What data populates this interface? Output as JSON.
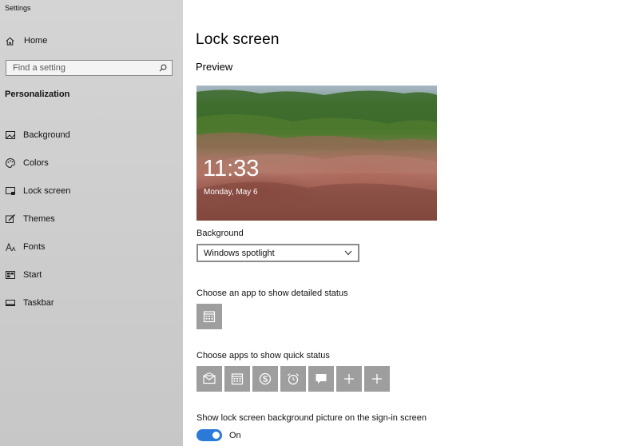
{
  "app": {
    "title": "Settings"
  },
  "sidebar": {
    "home_label": "Home",
    "search_placeholder": "Find a setting",
    "section_title": "Personalization",
    "items": [
      {
        "label": "Background",
        "icon": "picture-icon"
      },
      {
        "label": "Colors",
        "icon": "palette-icon"
      },
      {
        "label": "Lock screen",
        "icon": "lock-screen-icon"
      },
      {
        "label": "Themes",
        "icon": "themes-icon"
      },
      {
        "label": "Fonts",
        "icon": "fonts-icon"
      },
      {
        "label": "Start",
        "icon": "start-icon"
      },
      {
        "label": "Taskbar",
        "icon": "taskbar-icon"
      }
    ]
  },
  "main": {
    "title": "Lock screen",
    "preview_title": "Preview",
    "preview_time": "11:33",
    "preview_date": "Monday, May 6",
    "background_label": "Background",
    "background_value": "Windows spotlight",
    "detailed_status_label": "Choose an app to show detailed status",
    "detailed_status_app": "calendar-icon",
    "quick_status_label": "Choose apps to show quick status",
    "quick_status_apps": [
      "mail-icon",
      "calendar-icon",
      "skype-icon",
      "alarm-icon",
      "messaging-icon",
      "plus-icon",
      "plus-icon"
    ],
    "signin_label": "Show lock screen background picture on the sign-in screen",
    "signin_toggle_state": "On"
  },
  "colors": {
    "accent": "#2b79d8",
    "tile": "#9e9e9e",
    "sidebar": "#cfcfcf"
  }
}
